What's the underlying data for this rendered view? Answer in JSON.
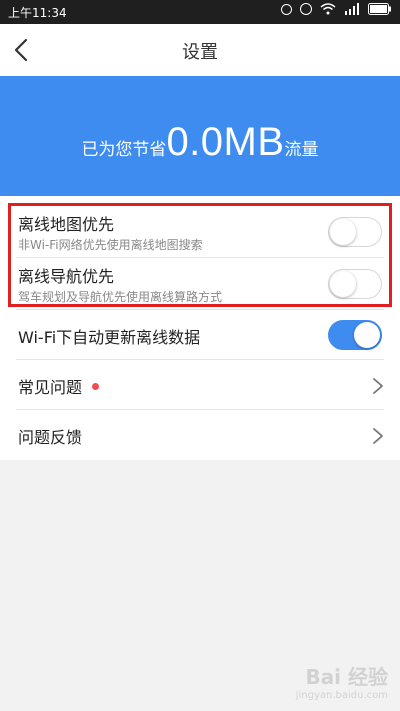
{
  "status_bar": {
    "time": "上午11:34",
    "icons": [
      "hotspot-icon",
      "alarm-icon",
      "wifi-icon",
      "signal-icon",
      "battery-icon"
    ]
  },
  "nav": {
    "title": "设置",
    "back_icon": "back-arrow-icon"
  },
  "banner": {
    "prefix": "已为您节省",
    "amount": "0.0MB",
    "suffix": "流量",
    "color": "#3f8cf0"
  },
  "settings": [
    {
      "title": "离线地图优先",
      "subtitle": "非Wi-Fi网络优先使用离线地图搜索",
      "toggle": false
    },
    {
      "title": "离线导航优先",
      "subtitle": "驾车规划及导航优先使用离线算路方式",
      "toggle": false
    },
    {
      "title": "Wi-Fi下自动更新离线数据",
      "toggle": true
    },
    {
      "title": "常见问题",
      "badge": "red-dot"
    },
    {
      "title": "问题反馈"
    }
  ],
  "highlight_color": "#e02020",
  "watermark": {
    "brand": "Bai 经验",
    "sub": "jingyan.baidu.com"
  }
}
